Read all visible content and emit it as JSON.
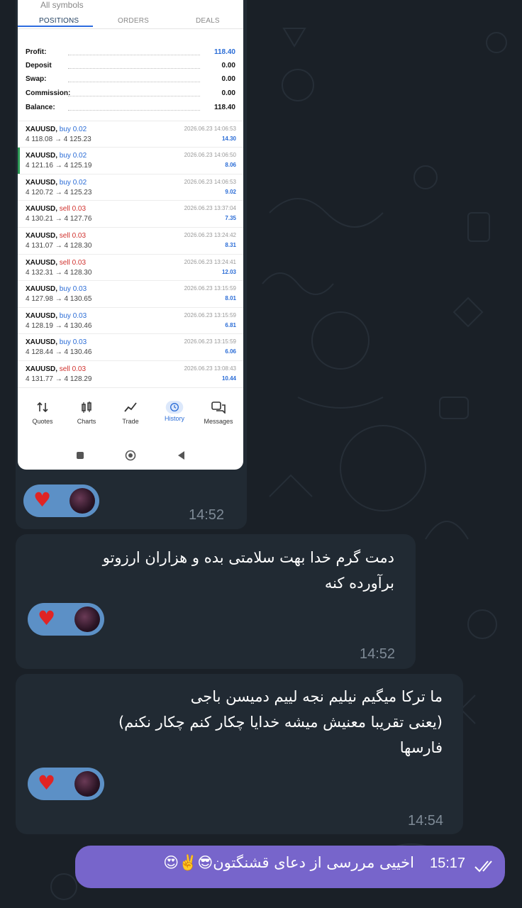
{
  "screenshot": {
    "top_label": "All symbols",
    "tabs": [
      "POSITIONS",
      "ORDERS",
      "DEALS"
    ],
    "summary": [
      {
        "key": "Profit:",
        "value": "118.40"
      },
      {
        "key": "Deposit",
        "value": "0.00"
      },
      {
        "key": "Swap:",
        "value": "0.00"
      },
      {
        "key": "Commission:",
        "value": "0.00"
      },
      {
        "key": "Balance:",
        "value": "118.40"
      }
    ],
    "trades": [
      {
        "symbol": "XAUUSD,",
        "side": "buy 0.02",
        "prices": "4 118.08 → 4 125.23",
        "time": "2026.06.23 14:06:53",
        "profit": "14.30"
      },
      {
        "symbol": "XAUUSD,",
        "side": "buy 0.02",
        "prices": "4 121.16 → 4 125.19",
        "time": "2026.06.23 14:06:50",
        "profit": "8.06"
      },
      {
        "symbol": "XAUUSD,",
        "side": "buy 0.02",
        "prices": "4 120.72 → 4 125.23",
        "time": "2026.06.23 14:06:53",
        "profit": "9.02"
      },
      {
        "symbol": "XAUUSD,",
        "side": "sell 0.03",
        "prices": "4 130.21 → 4 127.76",
        "time": "2026.06.23 13:37:04",
        "profit": "7.35"
      },
      {
        "symbol": "XAUUSD,",
        "side": "sell 0.03",
        "prices": "4 131.07 → 4 128.30",
        "time": "2026.06.23 13:24:42",
        "profit": "8.31"
      },
      {
        "symbol": "XAUUSD,",
        "side": "sell 0.03",
        "prices": "4 132.31 → 4 128.30",
        "time": "2026.06.23 13:24:41",
        "profit": "12.03"
      },
      {
        "symbol": "XAUUSD,",
        "side": "buy 0.03",
        "prices": "4 127.98 → 4 130.65",
        "time": "2026.06.23 13:15:59",
        "profit": "8.01"
      },
      {
        "symbol": "XAUUSD,",
        "side": "buy 0.03",
        "prices": "4 128.19 → 4 130.46",
        "time": "2026.06.23 13:15:59",
        "profit": "6.81"
      },
      {
        "symbol": "XAUUSD,",
        "side": "buy 0.03",
        "prices": "4 128.44 → 4 130.46",
        "time": "2026.06.23 13:15:59",
        "profit": "6.06"
      },
      {
        "symbol": "XAUUSD,",
        "side": "sell 0.03",
        "prices": "4 131.77 → 4 128.29",
        "time": "2026.06.23 13:08:43",
        "profit": "10.44"
      }
    ],
    "nav": [
      "Quotes",
      "Charts",
      "Trade",
      "History",
      "Messages"
    ]
  },
  "messages": [
    {
      "time": "14:52"
    },
    {
      "lines": [
        "دمت گرم خدا بهت سلامتی بده و هزاران ارزوتو",
        "برآورده کنه"
      ],
      "time": "14:52"
    },
    {
      "lines": [
        "ما ترکا میگیم نیلیم نجه لییم دمیسن باجی",
        "(یعنی تقریبا معنیش میشه خدایا چکار کنم چکار نکنم)",
        "فارسها"
      ],
      "time": "14:54"
    }
  ],
  "outgoing": {
    "text": "اخییی مررسی از دعای قشنگتون😎✌️😍",
    "time": "15:17"
  },
  "colors": {
    "background": "#1a2027",
    "incoming_bubble": "#212a33",
    "outgoing_bubble": "#7765cb",
    "reaction": "#5c90c6",
    "accent": "#2a6cd6"
  },
  "icons": [
    "heart-icon",
    "read-checkmarks-icon",
    "quotes-icon",
    "charts-icon",
    "trade-icon",
    "history-icon",
    "messages-icon"
  ]
}
